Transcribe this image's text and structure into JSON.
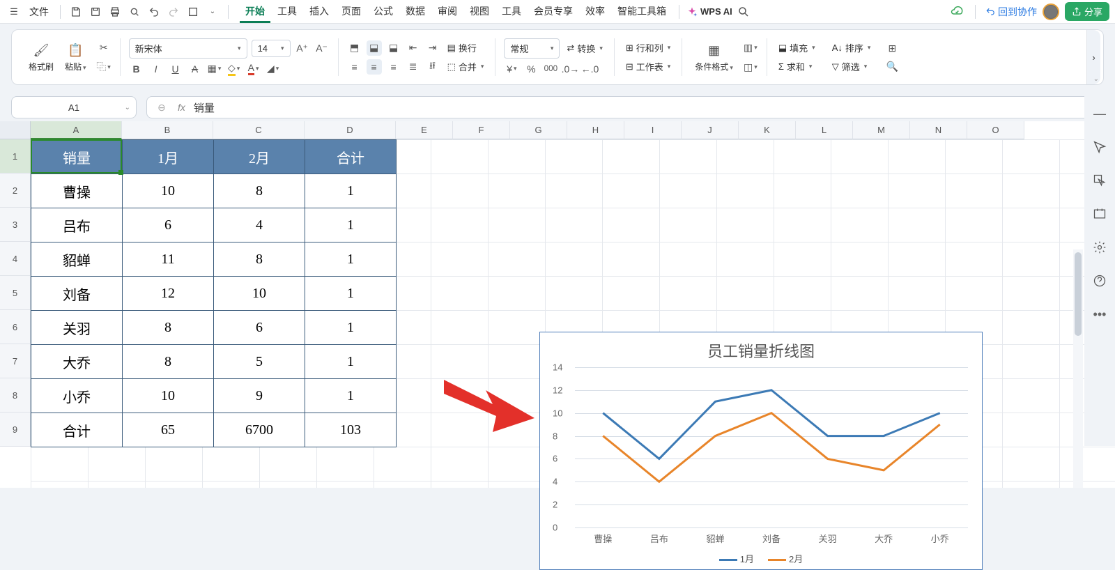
{
  "menu": {
    "file": "文件",
    "tabs": [
      "开始",
      "工具",
      "插入",
      "页面",
      "公式",
      "数据",
      "审阅",
      "视图",
      "工具",
      "会员专享",
      "效率",
      "智能工具箱"
    ],
    "active_tab": 0,
    "wps_ai": "WPS AI",
    "back_collab": "回到协作",
    "share": "分享"
  },
  "ribbon": {
    "format_painter": "格式刷",
    "paste": "粘贴",
    "font_name": "新宋体",
    "font_size": "14",
    "number_format": "常规",
    "wrap": "换行",
    "merge": "合并",
    "convert": "转换",
    "row_col": "行和列",
    "worksheet": "工作表",
    "cond_fmt": "条件格式",
    "fill": "填充",
    "sum": "求和",
    "sort": "排序",
    "filter": "筛选"
  },
  "namebox": "A1",
  "formula": "销量",
  "columns": [
    "A",
    "B",
    "C",
    "D",
    "E",
    "F",
    "G",
    "H",
    "I",
    "J",
    "K",
    "L",
    "M",
    "N",
    "O"
  ],
  "rows": [
    "1",
    "2",
    "3",
    "4",
    "5",
    "6",
    "7",
    "8",
    "9"
  ],
  "table": {
    "headers": [
      "销量",
      "1月",
      "2月",
      "合计"
    ],
    "rows": [
      [
        "曹操",
        "10",
        "8",
        "1"
      ],
      [
        "吕布",
        "6",
        "4",
        "1"
      ],
      [
        "貂蝉",
        "11",
        "8",
        "1"
      ],
      [
        "刘备",
        "12",
        "10",
        "1"
      ],
      [
        "关羽",
        "8",
        "6",
        "1"
      ],
      [
        "大乔",
        "8",
        "5",
        "1"
      ],
      [
        "小乔",
        "10",
        "9",
        "1"
      ],
      [
        "合计",
        "65",
        "6700",
        "103"
      ]
    ]
  },
  "chart_data": {
    "type": "line",
    "title": "员工销量折线图",
    "categories": [
      "曹操",
      "吕布",
      "貂蝉",
      "刘备",
      "关羽",
      "大乔",
      "小乔"
    ],
    "series": [
      {
        "name": "1月",
        "values": [
          10,
          6,
          11,
          12,
          8,
          8,
          10
        ],
        "color": "#3c7ab5"
      },
      {
        "name": "2月",
        "values": [
          8,
          4,
          8,
          10,
          6,
          5,
          9
        ],
        "color": "#e8852a"
      }
    ],
    "ylim": [
      0,
      14
    ],
    "yticks": [
      0,
      2,
      4,
      6,
      8,
      10,
      12,
      14
    ]
  }
}
